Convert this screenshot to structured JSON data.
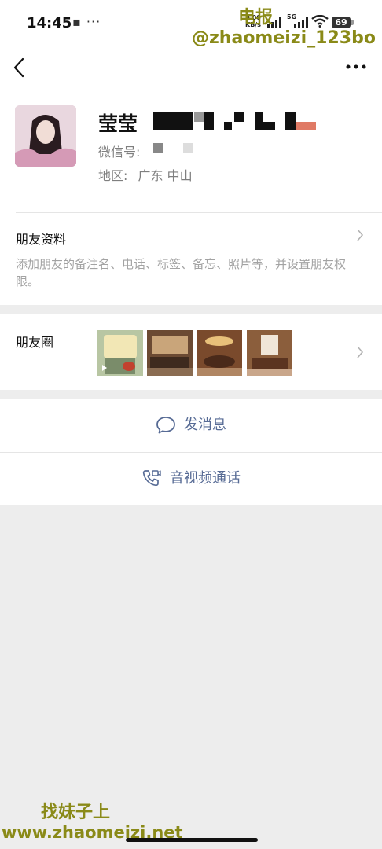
{
  "status_bar": {
    "time": "14:45",
    "net_speed_value": "0.00",
    "net_speed_unit": "KB/s",
    "network": "5G",
    "battery": "69"
  },
  "watermark": {
    "top_line1": "电报",
    "top_line2": "@zhaomeizi_123bo",
    "bottom_line1": "找妹子上",
    "bottom_line2": "www.zhaomeizi.net"
  },
  "profile": {
    "name": "莹莹",
    "wechat_id_label": "微信号:",
    "region_label": "地区:",
    "region_value": "广东  中山"
  },
  "friend_info": {
    "title": "朋友资料",
    "description": "添加朋友的备注名、电话、标签、备忘、照片等，并设置朋友权限。"
  },
  "moments": {
    "title": "朋友圈"
  },
  "actions": {
    "message": "发消息",
    "call": "音视频通话"
  },
  "colors": {
    "accent": "#576b95",
    "background": "#ededed"
  },
  "icons": {
    "back": "chevron-left-icon",
    "more": "more-dots-icon",
    "message": "chat-bubble-icon",
    "call": "phone-video-icon"
  }
}
